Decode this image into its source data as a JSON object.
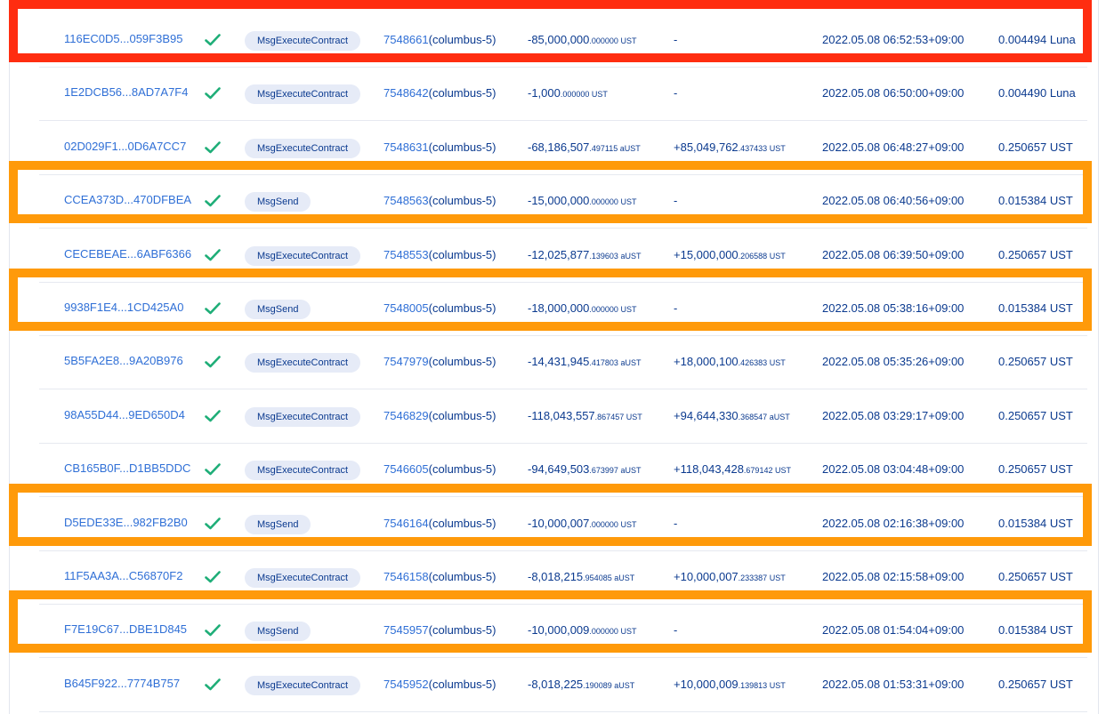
{
  "rows": [
    {
      "hash": "116EC0D5...059F3B95",
      "type": "MsgExecuteContract",
      "block": "7548661",
      "network": "(columbus-5)",
      "amount_main": "-85,000,000",
      "amount_dec": ".000000 UST",
      "amount2_main": "-",
      "amount2_dec": "",
      "time": "2022.05.08 06:52:53+09:00",
      "fee": "0.004494 Luna"
    },
    {
      "hash": "1E2DCB56...8AD7A7F4",
      "type": "MsgExecuteContract",
      "block": "7548642",
      "network": "(columbus-5)",
      "amount_main": "-1,000",
      "amount_dec": ".000000 UST",
      "amount2_main": "-",
      "amount2_dec": "",
      "time": "2022.05.08 06:50:00+09:00",
      "fee": "0.004490 Luna"
    },
    {
      "hash": "02D029F1...0D6A7CC7",
      "type": "MsgExecuteContract",
      "block": "7548631",
      "network": "(columbus-5)",
      "amount_main": "-68,186,507",
      "amount_dec": ".497115 aUST",
      "amount2_main": "+85,049,762",
      "amount2_dec": ".437433 UST",
      "time": "2022.05.08 06:48:27+09:00",
      "fee": "0.250657 UST"
    },
    {
      "hash": "CCEA373D...470DFBEA",
      "type": "MsgSend",
      "block": "7548563",
      "network": "(columbus-5)",
      "amount_main": "-15,000,000",
      "amount_dec": ".000000 UST",
      "amount2_main": "-",
      "amount2_dec": "",
      "time": "2022.05.08 06:40:56+09:00",
      "fee": "0.015384 UST"
    },
    {
      "hash": "CECEBEAE...6ABF6366",
      "type": "MsgExecuteContract",
      "block": "7548553",
      "network": "(columbus-5)",
      "amount_main": "-12,025,877",
      "amount_dec": ".139603 aUST",
      "amount2_main": "+15,000,000",
      "amount2_dec": ".206588 UST",
      "time": "2022.05.08 06:39:50+09:00",
      "fee": "0.250657 UST"
    },
    {
      "hash": "9938F1E4...1CD425A0",
      "type": "MsgSend",
      "block": "7548005",
      "network": "(columbus-5)",
      "amount_main": "-18,000,000",
      "amount_dec": ".000000 UST",
      "amount2_main": "-",
      "amount2_dec": "",
      "time": "2022.05.08 05:38:16+09:00",
      "fee": "0.015384 UST"
    },
    {
      "hash": "5B5FA2E8...9A20B976",
      "type": "MsgExecuteContract",
      "block": "7547979",
      "network": "(columbus-5)",
      "amount_main": "-14,431,945",
      "amount_dec": ".417803 aUST",
      "amount2_main": "+18,000,100",
      "amount2_dec": ".426383 UST",
      "time": "2022.05.08 05:35:26+09:00",
      "fee": "0.250657 UST"
    },
    {
      "hash": "98A55D44...9ED650D4",
      "type": "MsgExecuteContract",
      "block": "7546829",
      "network": "(columbus-5)",
      "amount_main": "-118,043,557",
      "amount_dec": ".867457 UST",
      "amount2_main": "+94,644,330",
      "amount2_dec": ".368547 aUST",
      "time": "2022.05.08 03:29:17+09:00",
      "fee": "0.250657 UST"
    },
    {
      "hash": "CB165B0F...D1BB5DDC",
      "type": "MsgExecuteContract",
      "block": "7546605",
      "network": "(columbus-5)",
      "amount_main": "-94,649,503",
      "amount_dec": ".673997 aUST",
      "amount2_main": "+118,043,428",
      "amount2_dec": ".679142 UST",
      "time": "2022.05.08 03:04:48+09:00",
      "fee": "0.250657 UST"
    },
    {
      "hash": "D5EDE33E...982FB2B0",
      "type": "MsgSend",
      "block": "7546164",
      "network": "(columbus-5)",
      "amount_main": "-10,000,007",
      "amount_dec": ".000000 UST",
      "amount2_main": "-",
      "amount2_dec": "",
      "time": "2022.05.08 02:16:38+09:00",
      "fee": "0.015384 UST"
    },
    {
      "hash": "11F5AA3A...C56870F2",
      "type": "MsgExecuteContract",
      "block": "7546158",
      "network": "(columbus-5)",
      "amount_main": "-8,018,215",
      "amount_dec": ".954085 aUST",
      "amount2_main": "+10,000,007",
      "amount2_dec": ".233387 UST",
      "time": "2022.05.08 02:15:58+09:00",
      "fee": "0.250657 UST"
    },
    {
      "hash": "F7E19C67...DBE1D845",
      "type": "MsgSend",
      "block": "7545957",
      "network": "(columbus-5)",
      "amount_main": "-10,000,009",
      "amount_dec": ".000000 UST",
      "amount2_main": "-",
      "amount2_dec": "",
      "time": "2022.05.08 01:54:04+09:00",
      "fee": "0.015384 UST"
    },
    {
      "hash": "B645F922...7774B757",
      "type": "MsgExecuteContract",
      "block": "7545952",
      "network": "(columbus-5)",
      "amount_main": "-8,018,225",
      "amount_dec": ".190089 aUST",
      "amount2_main": "+10,000,009",
      "amount2_dec": ".139813 UST",
      "time": "2022.05.08 01:53:31+09:00",
      "fee": "0.250657 UST"
    }
  ],
  "highlights": [
    {
      "row": 0,
      "color": "#ff2d10"
    },
    {
      "row": 3,
      "color": "#ff9a0a"
    },
    {
      "row": 5,
      "color": "#ff9a0a"
    },
    {
      "row": 9,
      "color": "#ff9a0a"
    },
    {
      "row": 11,
      "color": "#ff9a0a"
    }
  ],
  "colors": {
    "link": "#2f6fd6",
    "text": "#0b3a8f",
    "check": "#1fae78",
    "pill_bg": "#e6ebf7"
  },
  "icons": {
    "status": "check-icon"
  }
}
